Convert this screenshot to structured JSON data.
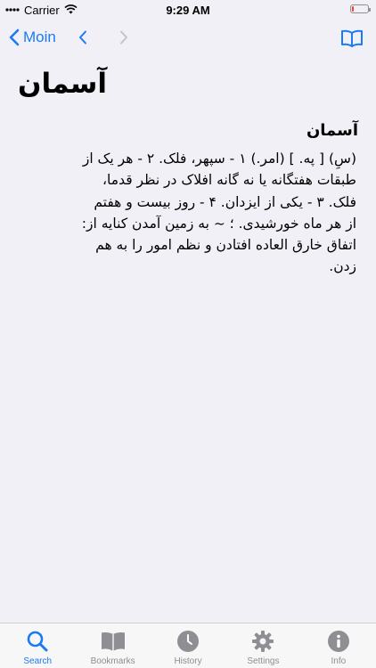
{
  "status_bar": {
    "carrier": "Carrier",
    "time": "9:29 AM"
  },
  "nav": {
    "back_label": "Moin"
  },
  "entry": {
    "headword": "آسمان",
    "title": "آسمان",
    "definition_lines": [
      "(سِ) [ په. ] (امر.) ۱ - سپهر، فلک. ۲ - هر یک از",
      "طبقات هفتگانه یا نه گانه افلاک در نظر قدما،",
      "فلک. ۳ - یکی از ایزدان. ۴ - روز بیست و هفتم",
      "از هر ماه خورشیدی. ؛ ~ به زمین آمدن کنایه از:",
      "اتفاق خارق العاده افتادن و نظم امور را به هم",
      "زدن."
    ]
  },
  "tabs": [
    {
      "label": "Search",
      "icon": "search-icon",
      "active": true
    },
    {
      "label": "Bookmarks",
      "icon": "bookmarks-icon",
      "active": false
    },
    {
      "label": "History",
      "icon": "history-icon",
      "active": false
    },
    {
      "label": "Settings",
      "icon": "settings-icon",
      "active": false
    },
    {
      "label": "Info",
      "icon": "info-icon",
      "active": false
    }
  ],
  "colors": {
    "accent": "#1a7bf2",
    "inactive": "#8e8e93",
    "background": "#f1f0f6"
  }
}
